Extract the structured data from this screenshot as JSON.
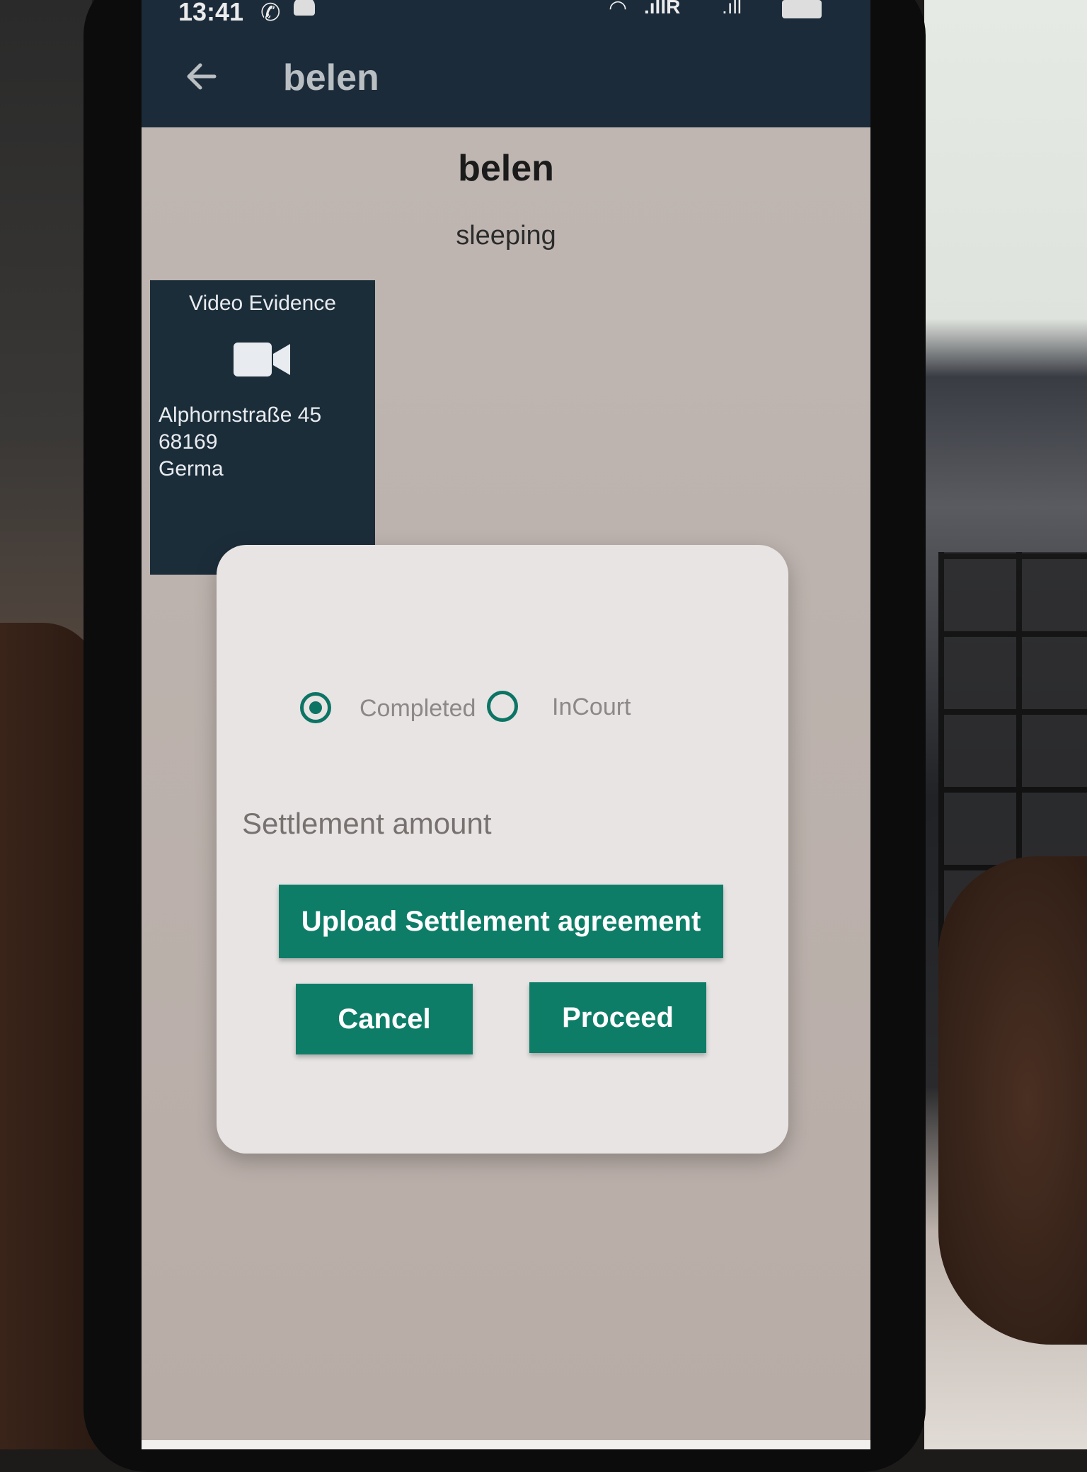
{
  "status_bar": {
    "time": "13:41",
    "icons": [
      "whatsapp-icon",
      "notification-icon",
      "wifi-icon",
      "signal-icon",
      "battery-icon"
    ],
    "signal1_text": ".ıllR",
    "signal2_text": ".ıll"
  },
  "app_bar": {
    "title": "belen",
    "back_icon": "arrow-left-icon"
  },
  "header": {
    "name": "belen",
    "status": "sleeping"
  },
  "video_card": {
    "label": "Video Evidence",
    "icon": "video-camera-icon",
    "address": "Alphornstraße 45\n68169\nGerma"
  },
  "dialog": {
    "options": [
      {
        "label": "Completed",
        "selected": true
      },
      {
        "label": "InCourt",
        "selected": false
      }
    ],
    "field_label": "Settlement amount",
    "upload_label": "Upload Settlement agreement",
    "cancel_label": "Cancel",
    "proceed_label": "Proceed"
  },
  "colors": {
    "app_bar": "#1c2b3a",
    "accent": "#0d7d68",
    "dialog_bg": "#e7e4e3"
  }
}
